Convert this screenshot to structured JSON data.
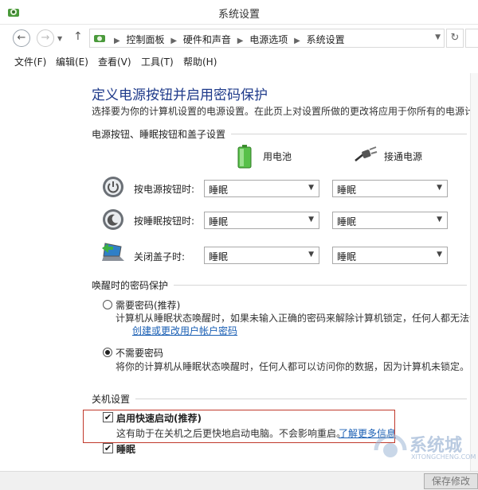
{
  "window": {
    "title": "系统设置"
  },
  "address": {
    "crumbs": [
      "控制面板",
      "硬件和声音",
      "电源选项",
      "系统设置"
    ]
  },
  "menu": [
    "文件(F)",
    "编辑(E)",
    "查看(V)",
    "工具(T)",
    "帮助(H)"
  ],
  "main": {
    "heading": "定义电源按钮并启用密码保护",
    "subtitle": "选择要为你的计算机设置的电源设置。在此页上对设置所做的更改将应用于你所有的电源计划。",
    "power_section": {
      "title": "电源按钮、睡眠按钮和盖子设置",
      "col_battery": "用电池",
      "col_plugged": "接通电源",
      "rows": [
        {
          "label": "按电源按钮时:",
          "battery": "睡眠",
          "plugged": "睡眠"
        },
        {
          "label": "按睡眠按钮时:",
          "battery": "睡眠",
          "plugged": "睡眠"
        },
        {
          "label": "关闭盖子时:",
          "battery": "睡眠",
          "plugged": "睡眠"
        }
      ]
    },
    "password_section": {
      "title": "唤醒时的密码保护",
      "require": {
        "label": "需要密码(推荐)",
        "desc": "计算机从睡眠状态唤醒时，如果未输入正确的密码来解除计算机锁定，任何人都无法访问...",
        "link": "创建或更改用户帐户密码",
        "selected": false
      },
      "no_require": {
        "label": "不需要密码",
        "desc": "将你的计算机从睡眠状态唤醒时，任何人都可以访问你的数据，因为计算机未锁定。",
        "selected": true
      }
    },
    "shutdown_section": {
      "title": "关机设置",
      "fast_startup": {
        "label": "启用快速启动(推荐)",
        "desc": "这有助于在关机之后更快地启动电脑。不会影响重启。",
        "link": "了解更多信息",
        "checked": true
      },
      "sleep": {
        "label": "睡眠",
        "checked": true
      }
    }
  },
  "footer": {
    "save_label": "保存修改"
  },
  "watermark": {
    "text": "系统城",
    "sub": "XITONGCHENG.COM"
  }
}
